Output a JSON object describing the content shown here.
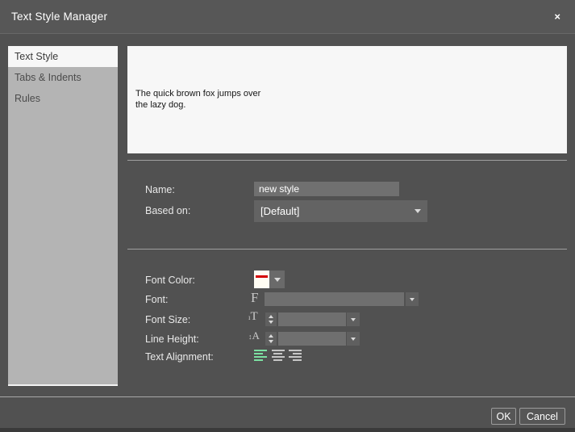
{
  "colors": {
    "dialog_bg": "#515151",
    "titlebar_bg": "#575757",
    "sidebar_bg": "#b4b4b4",
    "selected_tab_bg": "#f7f7f7",
    "preview_bg": "#f7f7f7",
    "field_bg": "#6f6f6f",
    "accent_green": "#7ce0a2",
    "swatch_red": "#d40000",
    "swatch_white": "#fffdf3"
  },
  "titlebar": {
    "title": "Text Style Manager",
    "close_icon": "×"
  },
  "sidebar": {
    "tabs": [
      {
        "label": "Text Style",
        "selected": true
      },
      {
        "label": "Tabs & Indents",
        "selected": false
      },
      {
        "label": "Rules",
        "selected": false
      }
    ]
  },
  "preview": {
    "text": "The quick brown fox jumps over the lazy dog."
  },
  "form": {
    "name": {
      "label": "Name:",
      "value": "new style"
    },
    "based_on": {
      "label": "Based on:",
      "value": "[Default]"
    },
    "font_color": {
      "label": "Font Color:"
    },
    "font": {
      "label": "Font:",
      "value": "",
      "icon": "F"
    },
    "font_size": {
      "label": "Font Size:",
      "value": "",
      "icon_small": "ı",
      "icon_big": "T"
    },
    "line_height": {
      "label": "Line Height:",
      "value": "",
      "icon_small": "↕",
      "icon_big": "A"
    },
    "text_alignment": {
      "label": "Text Alignment:",
      "selected": "left",
      "options": [
        "left",
        "center",
        "right"
      ]
    }
  },
  "footer": {
    "ok_label": "OK",
    "cancel_label": "Cancel"
  }
}
